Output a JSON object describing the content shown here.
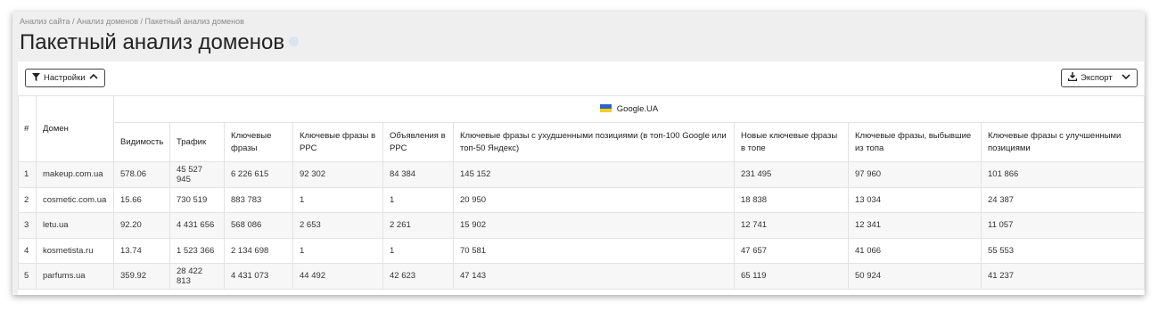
{
  "breadcrumb": "Анализ сайта / Анализ доменов / Пакетный анализ доменов",
  "title": "Пакетный анализ доменов",
  "toolbar": {
    "settings_label": "Настройки",
    "export_label": "Экспорт"
  },
  "colors": {
    "flag_blue": "#2f63c6",
    "flag_yellow": "#f5cf1a"
  },
  "table": {
    "index_header": "#",
    "domain_header": "Домен",
    "engine_label": "Google.UA",
    "columns": [
      "Видимость",
      "Трафик",
      "Ключевые фразы",
      "Ключевые фразы в PPC",
      "Объявления в PPC",
      "Ключевые фразы с ухудшенными позициями (в топ-100 Google или топ-50 Яндекс)",
      "Новые ключевые фразы в топе",
      "Ключевые фразы, выбывшие из топа",
      "Ключевые фразы с улучшенными позициями"
    ],
    "rows": [
      {
        "n": "1",
        "domain": "makeup.com.ua",
        "cells": [
          "578.06",
          "45 527 945",
          "6 226 615",
          "92 302",
          "84 384",
          "145 152",
          "231 495",
          "97 960",
          "101 866"
        ]
      },
      {
        "n": "2",
        "domain": "cosmetic.com.ua",
        "cells": [
          "15.66",
          "730 519",
          "883 783",
          "1",
          "1",
          "20 950",
          "18 838",
          "13 034",
          "24 387"
        ]
      },
      {
        "n": "3",
        "domain": "letu.ua",
        "cells": [
          "92.20",
          "4 431 656",
          "568 086",
          "2 653",
          "2 261",
          "15 902",
          "12 741",
          "12 341",
          "11 057"
        ]
      },
      {
        "n": "4",
        "domain": "kosmetista.ru",
        "cells": [
          "13.74",
          "1 523 366",
          "2 134 698",
          "1",
          "1",
          "70 581",
          "47 657",
          "41 066",
          "55 553"
        ]
      },
      {
        "n": "5",
        "domain": "parfums.ua",
        "cells": [
          "359.92",
          "28 422 813",
          "4 431 073",
          "44 492",
          "42 623",
          "47 143",
          "65 119",
          "50 924",
          "41 237"
        ]
      }
    ]
  }
}
